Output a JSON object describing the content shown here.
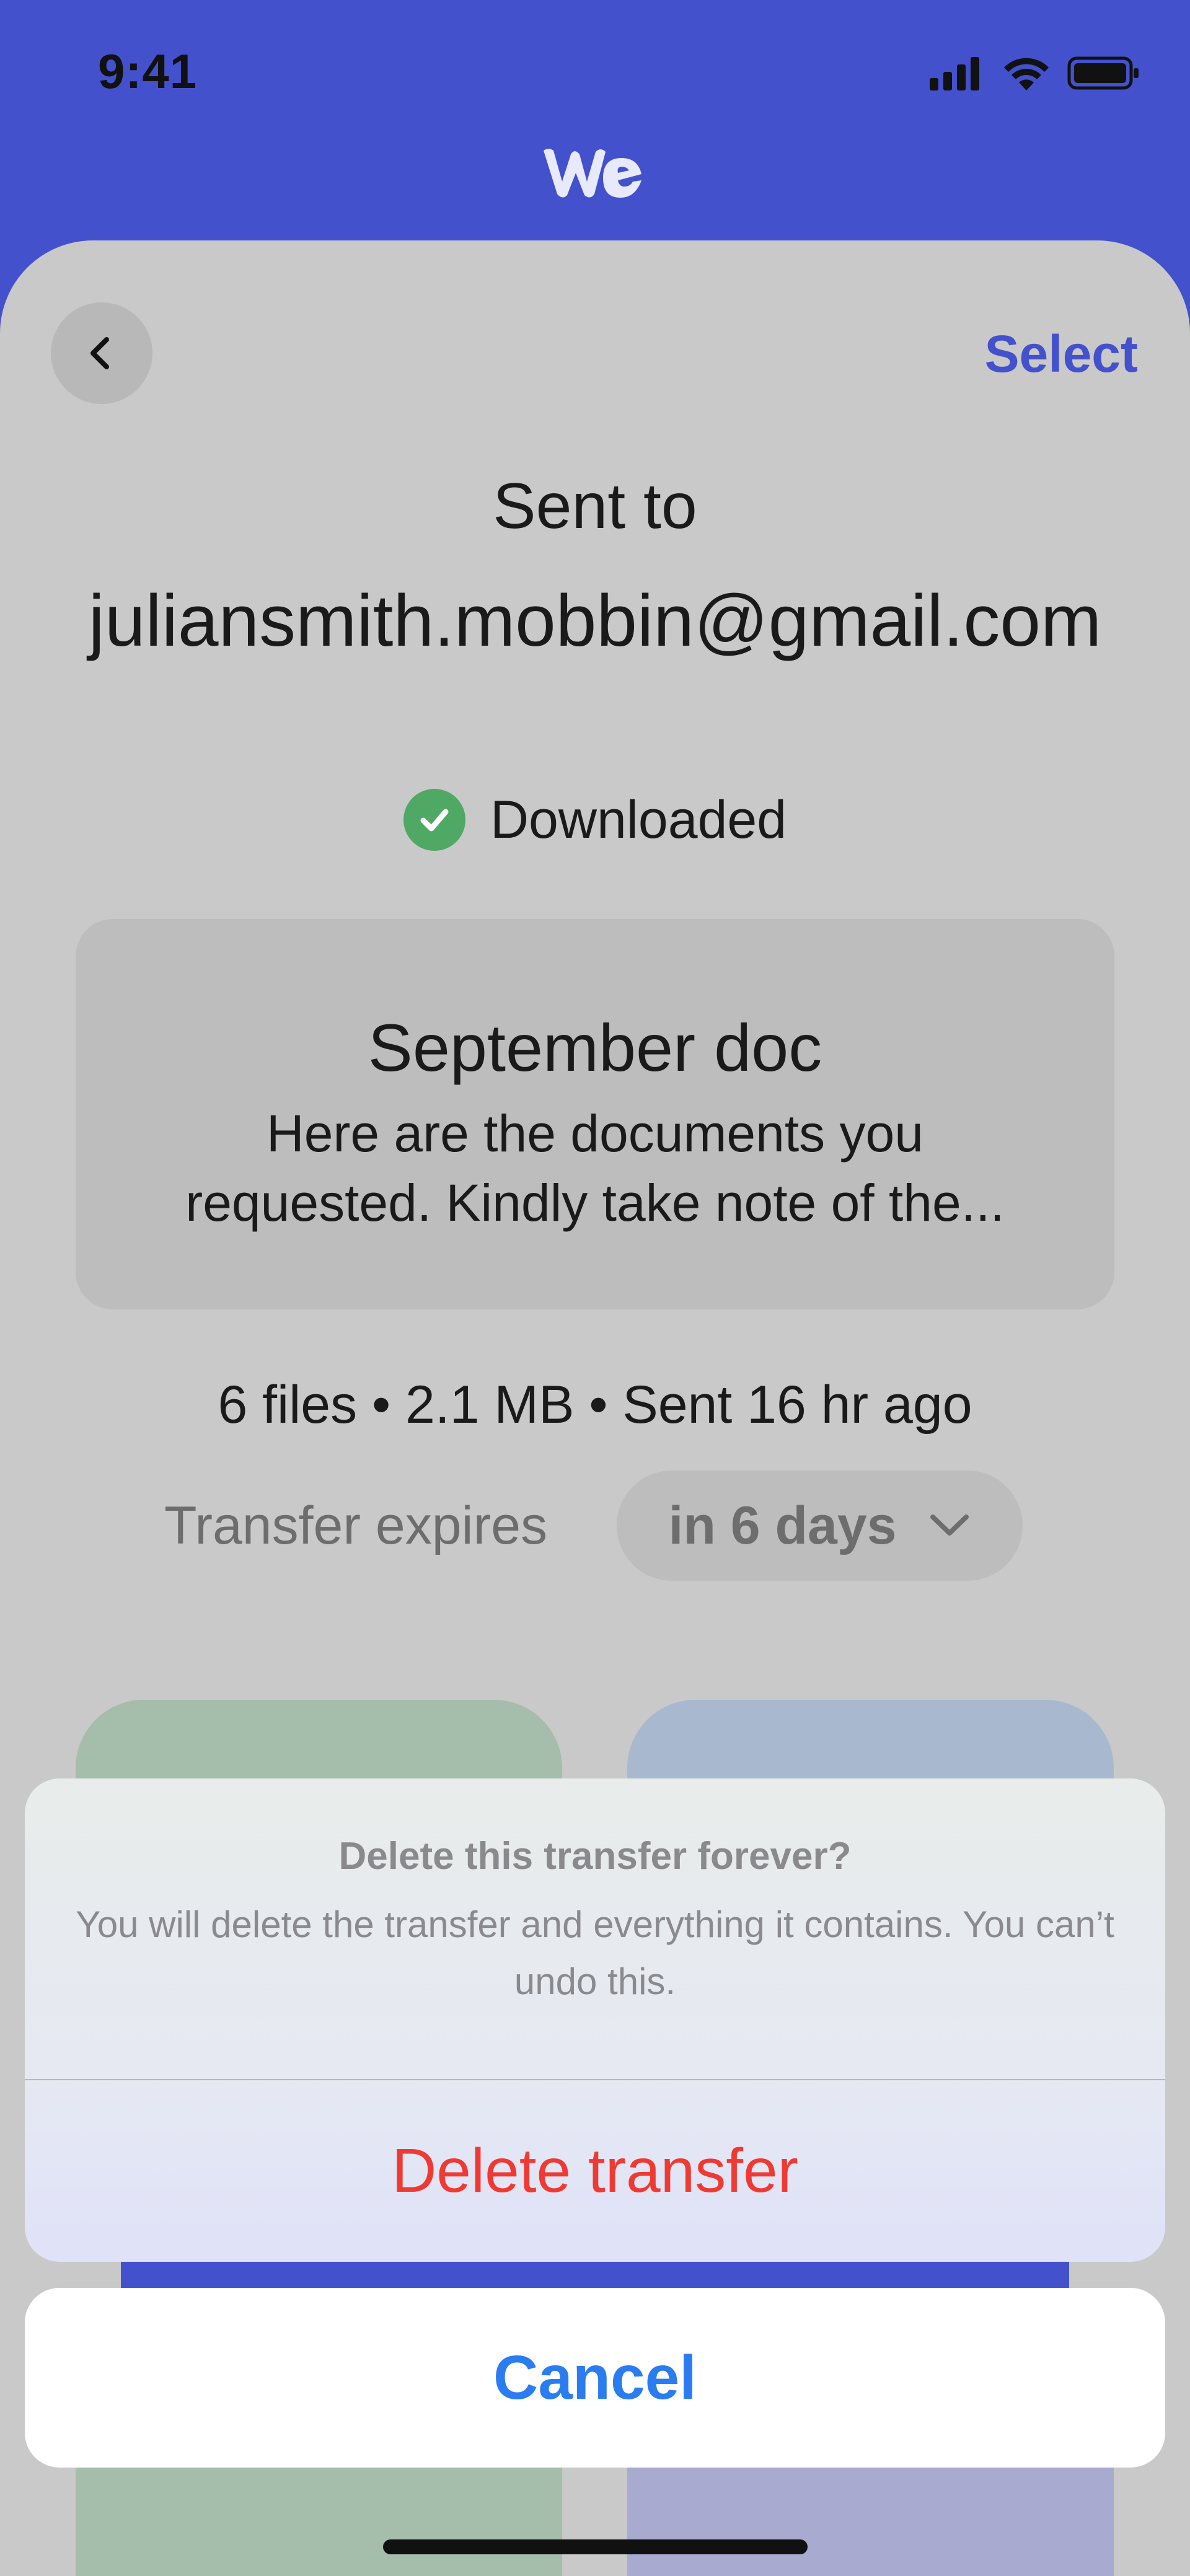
{
  "status_bar": {
    "time": "9:41",
    "icons": [
      "cellular-signal-icon",
      "wifi-icon",
      "battery-icon"
    ]
  },
  "app": {
    "logo_icon": "wetransfer-logo"
  },
  "header": {
    "back_icon": "chevron-left-icon",
    "select_label": "Select"
  },
  "transfer": {
    "sent_to_label": "Sent to",
    "recipient_email": "juliansmith.mobbin@gmail.com",
    "status": "Downloaded",
    "title": "September doc",
    "message": "Here are the documents you requested. Kindly take note of the...",
    "meta": "6 files • 2.1 MB • Sent 16 hr ago",
    "expires_label": "Transfer expires",
    "expires_value": "in 6 days"
  },
  "action_sheet": {
    "title": "Delete this transfer forever?",
    "message": "You will delete the transfer and everything it contains. You can’t undo this.",
    "destructive_label": "Delete transfer",
    "cancel_label": "Cancel"
  },
  "colors": {
    "brand": "#4351CC",
    "destructive": "#EF3A33",
    "ios_blue": "#2A7CF0",
    "success": "#4FA863"
  }
}
